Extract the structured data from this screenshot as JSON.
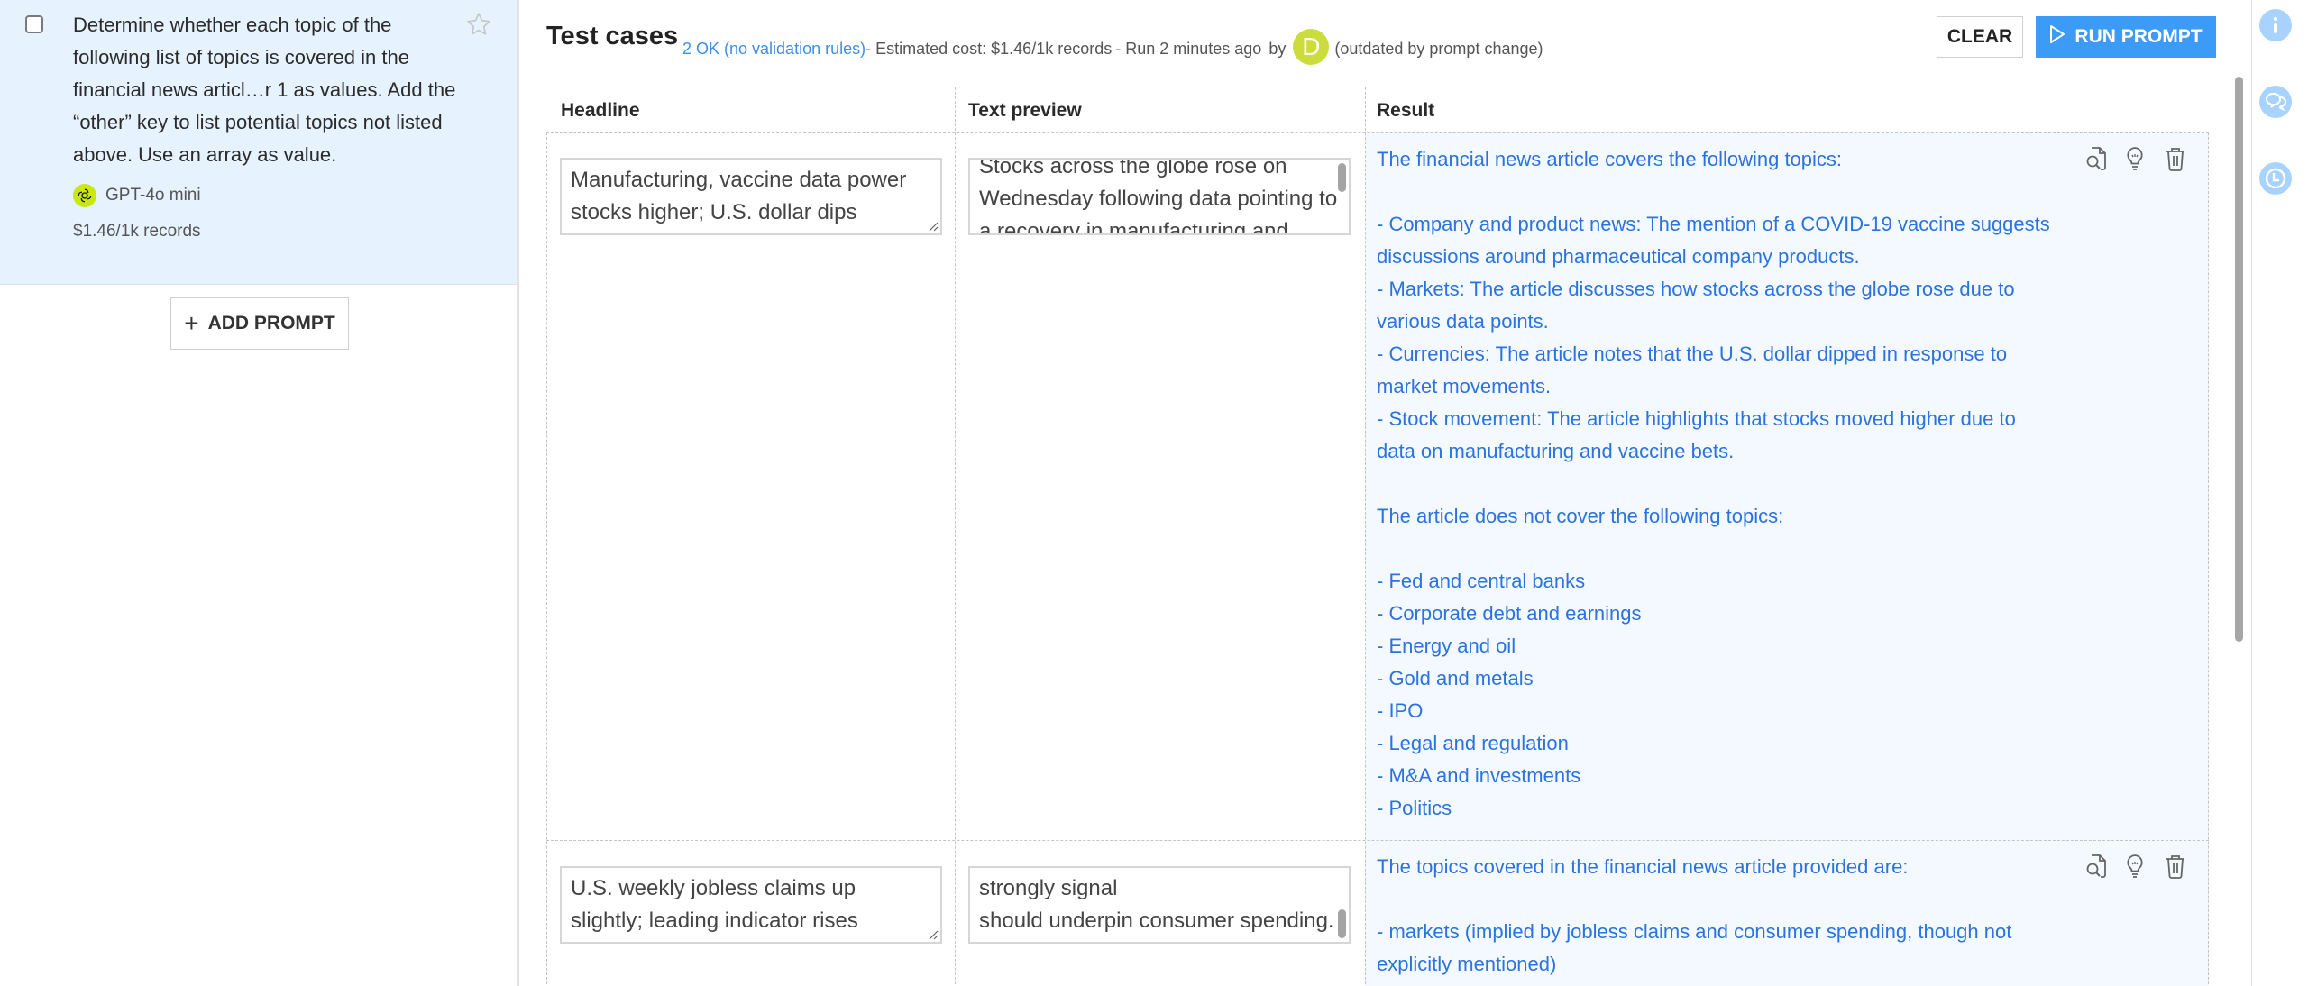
{
  "prompt_panel": {
    "prompt_text": "Determine whether each topic of the following list of topics is covered in the financial news articl…r 1 as values. Add the “other” key to list potential topics not listed above. Use an array as value.",
    "model_name": "GPT-4o mini",
    "model_icon": "openai-logo-icon",
    "cost": "$1.46/1k records",
    "starred": false,
    "checked": false,
    "add_prompt_label": "ADD PROMPT"
  },
  "header": {
    "title": "Test cases",
    "ok_status": "2 OK (no validation rules)",
    "estimated_cost": " - Estimated cost: $1.46/1k records",
    "run_time": " - Run 2 minutes ago",
    "by_label": "by",
    "user_initial": "D",
    "outdated_note": "(outdated by prompt change)",
    "clear_label": "CLEAR",
    "run_label": "RUN PROMPT"
  },
  "table": {
    "columns": [
      "Headline",
      "Text preview",
      "Result"
    ],
    "rows": [
      {
        "headline": "Manufacturing, vaccine data power stocks higher; U.S. dollar dips",
        "text_preview": "Stocks across the globe rose on Wednesday following data pointing to a recovery in manufacturing and",
        "result": "The financial news article covers the following topics:\n\n- Company and product news: The mention of a COVID-19 vaccine suggests\ndiscussions around pharmaceutical company products.\n- Markets: The article discusses how stocks across the globe rose due to\nvarious data points.\n- Currencies: The article notes that the U.S. dollar dipped in response to\nmarket movements.\n- Stock movement: The article highlights that stocks moved higher due to\ndata on manufacturing and vaccine bets.\n\nThe article does not cover the following topics:\n\n- Fed and central banks\n- Corporate debt and earnings\n- Energy and oil\n- Gold and metals\n- IPO\n- Legal and regulation\n- M&A and investments\n- Politics"
      },
      {
        "headline": "U.S. weekly jobless claims up slightly; leading indicator rises",
        "text_preview": "strongly signal\nshould underpin consumer spending.",
        "result": "The topics covered in the financial news article provided are:\n\n- markets (implied by jobless claims and consumer spending, though not\nexplicitly mentioned)"
      }
    ],
    "row_actions": [
      "inspect-icon",
      "lightbulb-icon",
      "trash-icon"
    ]
  },
  "right_rail": {
    "icons": [
      "info-icon",
      "chat-icon",
      "history-icon"
    ]
  },
  "colors": {
    "accent": "#3d9bf8",
    "link": "#3d8fe8",
    "result_text": "#2a73e0",
    "prompt_card_bg": "#e6f2fd",
    "result_bg": "#f4f9ff",
    "model_badge": "#c8e810",
    "avatar": "#ccdc3c",
    "rail_icon": "#a9d3ff"
  }
}
